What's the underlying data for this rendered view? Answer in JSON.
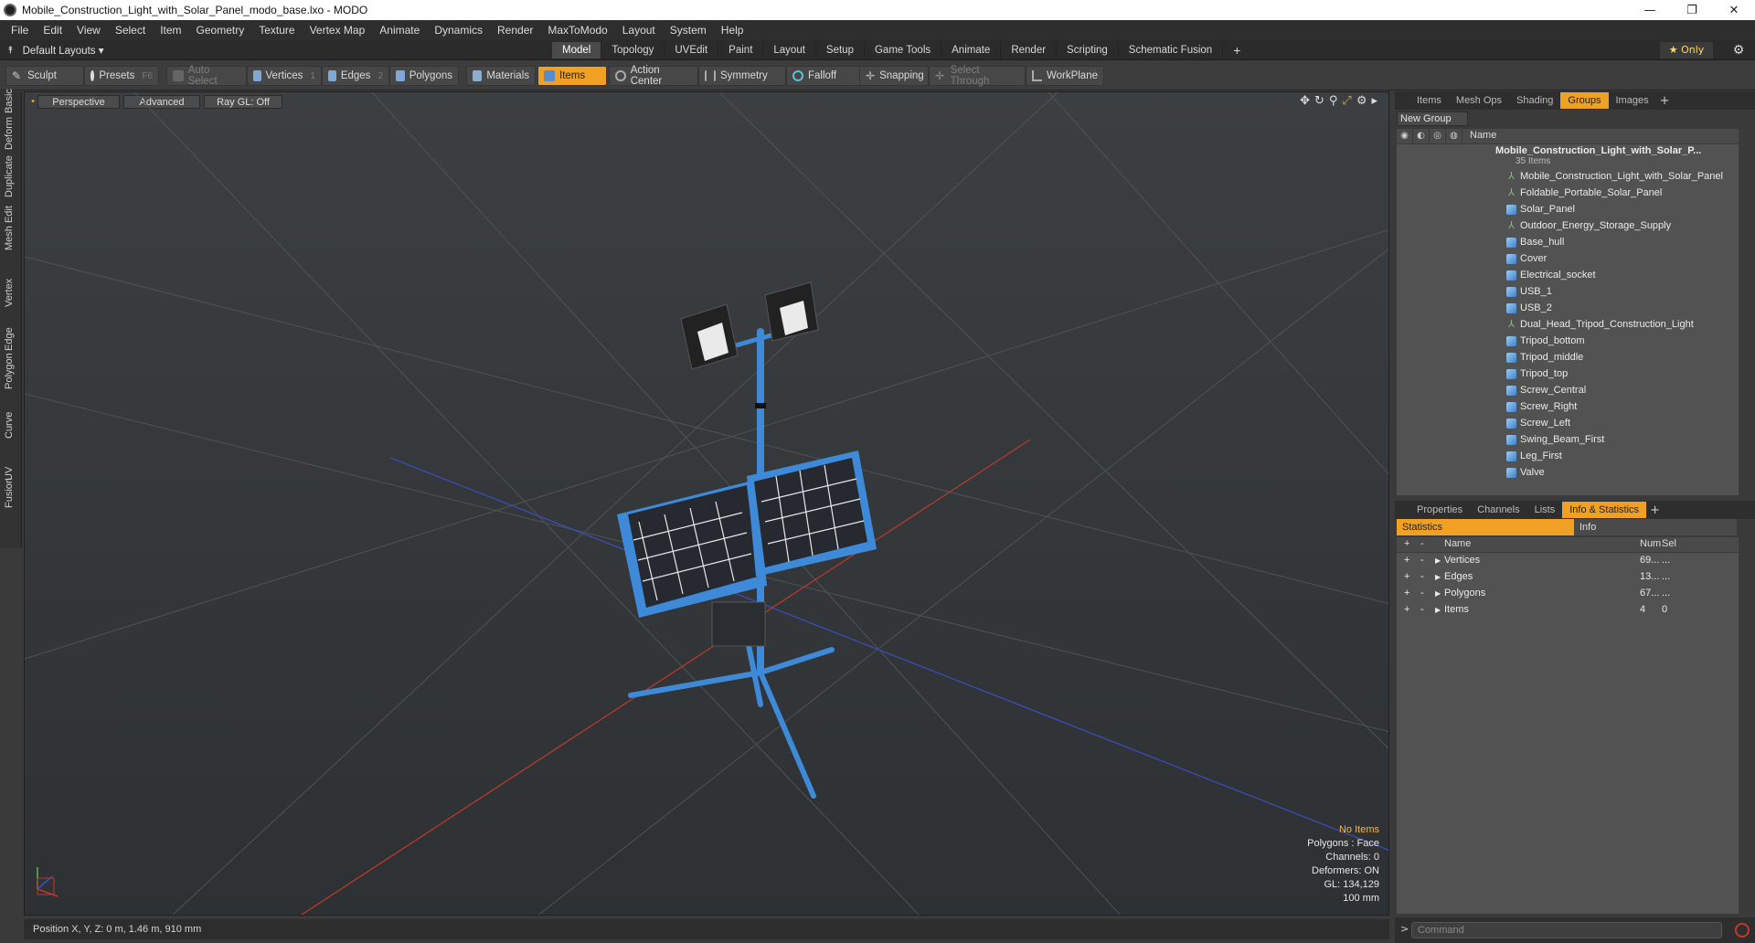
{
  "window": {
    "title": "Mobile_Construction_Light_with_Solar_Panel_modo_base.lxo - MODO",
    "minimize": "—",
    "maximize": "❐",
    "close": "✕"
  },
  "menu": [
    "File",
    "Edit",
    "View",
    "Select",
    "Item",
    "Geometry",
    "Texture",
    "Vertex Map",
    "Animate",
    "Dynamics",
    "Render",
    "MaxToModo",
    "Layout",
    "System",
    "Help"
  ],
  "layoutbar": {
    "layouts_label": "Default Layouts ▾",
    "tabs": [
      "Model",
      "Topology",
      "UVEdit",
      "Paint",
      "Layout",
      "Setup",
      "Game Tools",
      "Animate",
      "Render",
      "Scripting",
      "Schematic Fusion"
    ],
    "active_tab": "Model",
    "add": "+",
    "only_label": "★  Only"
  },
  "toolbar": {
    "sculpt": "Sculpt",
    "presets": "Presets",
    "presets_key": "F6",
    "auto_select": "Auto Select",
    "vertices": "Vertices",
    "vertices_count": "1",
    "edges": "Edges",
    "edges_count": "2",
    "polygons": "Polygons",
    "materials": "Materials",
    "items": "Items",
    "action_center": "Action Center",
    "symmetry": "Symmetry",
    "falloff": "Falloff",
    "snapping": "Snapping",
    "select_through": "Select Through",
    "workplane": "WorkPlane"
  },
  "left_tabs": [
    "Basic",
    "Deform",
    "Duplicate",
    "Mesh Edit",
    "Vertex",
    "Edge",
    "Polygon",
    "Curve",
    "UV",
    "Fusion"
  ],
  "viewport": {
    "perspective": "Perspective",
    "advanced": "Advanced",
    "raygl": "Ray GL: Off",
    "info": {
      "no_items": "No Items",
      "polygons": "Polygons : Face",
      "channels": "Channels: 0",
      "deformers": "Deformers: ON",
      "gl": "GL: 134,129",
      "scale": "100 mm"
    }
  },
  "status": {
    "position": "Position X, Y, Z:   0 m, 1.46 m, 910 mm"
  },
  "groups_panel": {
    "tabs": [
      "Items",
      "Mesh Ops",
      "Shading",
      "Groups",
      "Images"
    ],
    "active_tab": "Groups",
    "new_group": "New Group",
    "name_header": "Name",
    "root": {
      "name": "Mobile_Construction_Light_with_Solar_P...",
      "count": "35 Items"
    },
    "items": [
      {
        "name": "Mobile_Construction_Light_with_Solar_Panel",
        "type": "locator"
      },
      {
        "name": "Foldable_Portable_Solar_Panel",
        "type": "locator"
      },
      {
        "name": "Solar_Panel",
        "type": "mesh"
      },
      {
        "name": "Outdoor_Energy_Storage_Supply",
        "type": "locator"
      },
      {
        "name": "Base_hull",
        "type": "mesh"
      },
      {
        "name": "Cover",
        "type": "mesh"
      },
      {
        "name": "Electrical_socket",
        "type": "mesh"
      },
      {
        "name": "USB_1",
        "type": "mesh"
      },
      {
        "name": "USB_2",
        "type": "mesh"
      },
      {
        "name": "Dual_Head_Tripod_Construction_Light",
        "type": "locator"
      },
      {
        "name": "Tripod_bottom",
        "type": "mesh"
      },
      {
        "name": "Tripod_middle",
        "type": "mesh"
      },
      {
        "name": "Tripod_top",
        "type": "mesh"
      },
      {
        "name": "Screw_Central",
        "type": "mesh"
      },
      {
        "name": "Screw_Right",
        "type": "mesh"
      },
      {
        "name": "Screw_Left",
        "type": "mesh"
      },
      {
        "name": "Swing_Beam_First",
        "type": "mesh"
      },
      {
        "name": "Leg_First",
        "type": "mesh"
      },
      {
        "name": "Valve",
        "type": "mesh"
      }
    ]
  },
  "stats_panel": {
    "tabs": [
      "Properties",
      "Channels",
      "Lists",
      "Info & Statistics"
    ],
    "active_tab": "Info & Statistics",
    "subtabs": [
      "Statistics",
      "Info"
    ],
    "headers": {
      "name": "Name",
      "num": "Num",
      "sel": "Sel"
    },
    "rows": [
      {
        "name": "Vertices",
        "num": "69...",
        "sel": "..."
      },
      {
        "name": "Edges",
        "num": "13...",
        "sel": "..."
      },
      {
        "name": "Polygons",
        "num": "67...",
        "sel": "..."
      },
      {
        "name": "Items",
        "num": "4",
        "sel": "0"
      }
    ]
  },
  "command": {
    "placeholder": "Command",
    "prompt": ">"
  },
  "colors": {
    "accent": "#f0a022",
    "tripod": "#3e8ad8",
    "x_axis": "#c43a2e",
    "z_axis": "#3a4fc4"
  }
}
